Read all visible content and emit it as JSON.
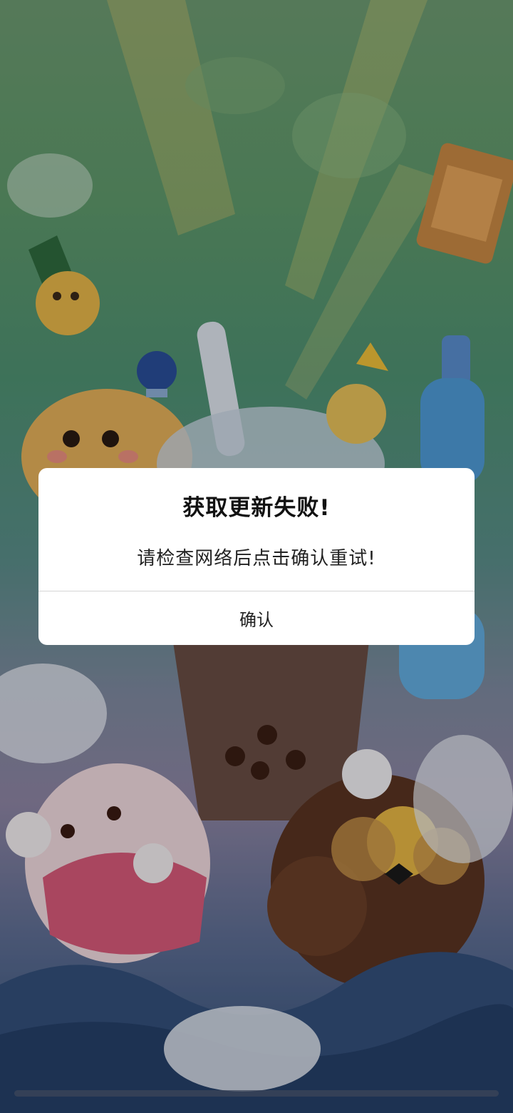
{
  "dialog": {
    "title": "获取更新失败!",
    "message": "请检查网络后点击确认重试!",
    "confirm_label": "确认"
  },
  "background": {
    "description_icons": [
      "pineapple-character",
      "muffin-character",
      "bubble-tea-character",
      "bottle-character",
      "mochi-character",
      "waffle-cookie-character",
      "toast-character",
      "lion-character"
    ]
  },
  "colors": {
    "dialog_bg": "#ffffff",
    "title_text": "#111111",
    "body_text": "#222222",
    "divider": "#d6d6d6"
  }
}
